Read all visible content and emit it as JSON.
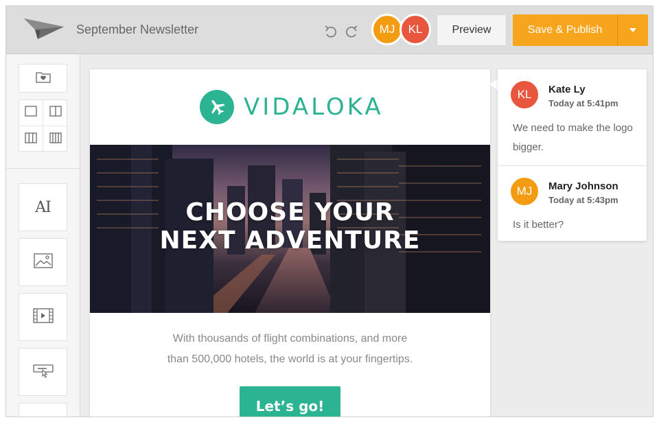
{
  "header": {
    "logo_icon": "paper-plane-icon",
    "title": "September Newsletter",
    "undo_icon": "undo-icon",
    "redo_icon": "redo-icon",
    "collaborators": [
      {
        "initials": "MJ",
        "color": "#f39c12"
      },
      {
        "initials": "KL",
        "color": "#e8573d"
      }
    ],
    "preview_label": "Preview",
    "publish_label": "Save & Publish",
    "publish_dropdown_icon": "caret-down-icon",
    "accent_color": "#f7a51d"
  },
  "toolbar": {
    "items": [
      {
        "name": "saved-blocks",
        "icon": "folder-heart-icon"
      },
      {
        "name": "layout-one-column",
        "icon": "one-column-icon"
      },
      {
        "name": "layout-two-column",
        "icon": "two-column-icon"
      },
      {
        "name": "layout-three-column",
        "icon": "three-column-icon"
      },
      {
        "name": "layout-four-column",
        "icon": "four-column-icon"
      },
      {
        "name": "text-block",
        "icon": "text-icon",
        "glyph": "AI"
      },
      {
        "name": "image-block",
        "icon": "image-icon"
      },
      {
        "name": "video-block",
        "icon": "video-icon"
      },
      {
        "name": "button-block",
        "icon": "button-icon"
      }
    ]
  },
  "email": {
    "brand_name": "VIDALOKA",
    "brand_color": "#2bb392",
    "hero_title_line1": "CHOOSE YOUR",
    "hero_title_line2": "NEXT ADVENTURE",
    "body_line1": "With thousands of flight combinations, and more",
    "body_line2": "than 500,000 hotels, the world is at your fingertips.",
    "cta_label": "Let’s go!"
  },
  "comments": [
    {
      "initials": "KL",
      "color": "#e8573d",
      "author": "Kate Ly",
      "time": "Today at 5:41pm",
      "text": "We need to make the logo bigger."
    },
    {
      "initials": "MJ",
      "color": "#f39c12",
      "author": "Mary Johnson",
      "time": "Today at 5:43pm",
      "text": "Is it better?"
    }
  ]
}
